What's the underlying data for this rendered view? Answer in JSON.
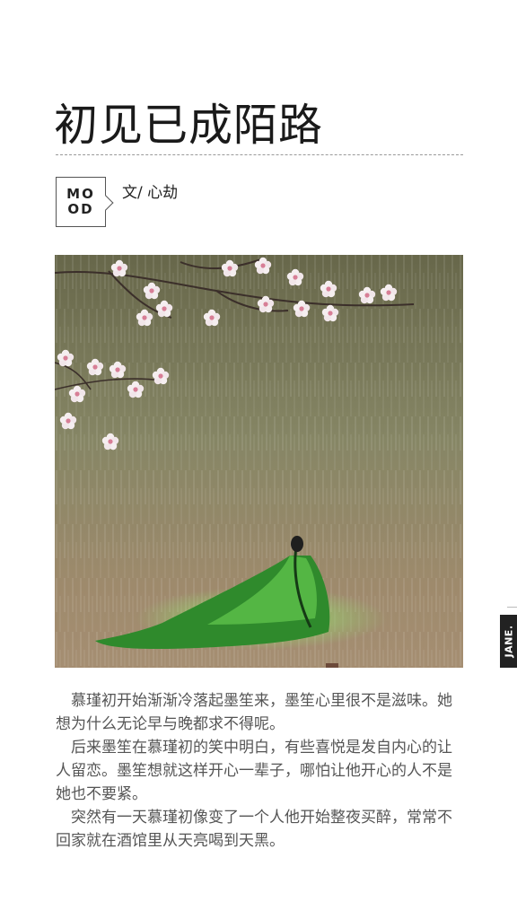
{
  "article": {
    "title": "初见已成陌路",
    "badge": {
      "line1": "MO",
      "line2": "OD"
    },
    "author": "文/ 心劫",
    "side_tag": "JANE.",
    "paragraphs": [
      "慕瑾初开始渐渐冷落起墨笙来，墨笙心里很不是滋味。她想为什么无论早与晚都求不得呢。",
      "后来墨笙在慕瑾初的笑中明白，有些喜悦是发自内心的让人留恋。墨笙想就这样开心一辈子，哪怕让他开心的人不是她也不要紧。",
      "突然有一天慕瑾初像变了一个人他开始整夜买醉，常常不回家就在酒馆里从天亮喝到天黑。"
    ]
  },
  "colors": {
    "rain_top": "#6b6c4e",
    "rain_mid": "#8a8a6a",
    "rain_bottom": "#a0876a",
    "blossom": "#f3e9ea",
    "blossom_center": "#d9859a",
    "robe_green": "#3fae3a"
  }
}
